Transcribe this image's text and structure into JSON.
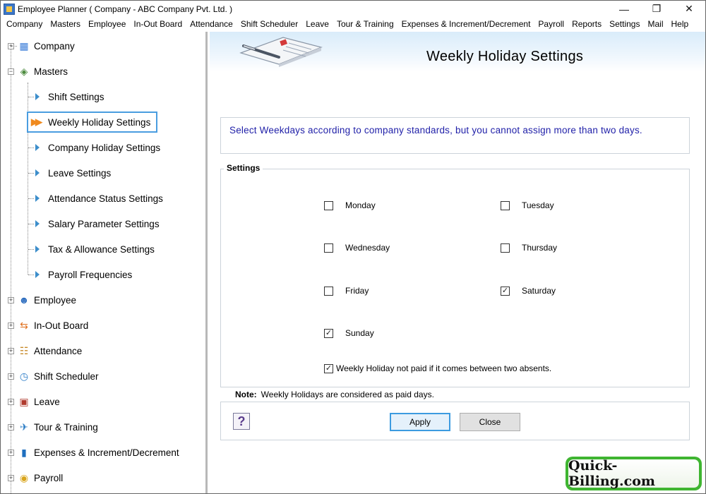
{
  "window": {
    "title": "Employee Planner ( Company - ABC Company Pvt. Ltd. )",
    "controls": [
      "minimize-icon",
      "restore-icon",
      "close-icon"
    ]
  },
  "menu": [
    "Company",
    "Masters",
    "Employee",
    "In-Out Board",
    "Attendance",
    "Shift Scheduler",
    "Leave",
    "Tour & Training",
    "Expenses & Increment/Decrement",
    "Payroll",
    "Reports",
    "Settings",
    "Mail",
    "Help"
  ],
  "tree": {
    "company": "Company",
    "masters": "Masters",
    "masters_children": [
      "Shift Settings",
      "Weekly Holiday Settings",
      "Company Holiday Settings",
      "Leave Settings",
      "Attendance Status Settings",
      "Salary Parameter Settings",
      "Tax & Allowance Settings",
      "Payroll Frequencies"
    ],
    "selected": "Weekly Holiday Settings",
    "others": [
      "Employee",
      "In-Out Board",
      "Attendance",
      "Shift Scheduler",
      "Leave",
      "Tour & Training",
      "Expenses & Increment/Decrement",
      "Payroll"
    ]
  },
  "page": {
    "title": "Weekly Holiday Settings",
    "info": "Select Weekdays according to company standards, but you cannot assign more than two days.",
    "settings_legend": "Settings",
    "days": [
      {
        "label": "Monday",
        "checked": false
      },
      {
        "label": "Tuesday",
        "checked": false
      },
      {
        "label": "Wednesday",
        "checked": false
      },
      {
        "label": "Thursday",
        "checked": false
      },
      {
        "label": "Friday",
        "checked": false
      },
      {
        "label": "Saturday",
        "checked": true
      },
      {
        "label": "Sunday",
        "checked": true
      }
    ],
    "not_paid_option": {
      "label": "Weekly Holiday not paid if it comes between two absents.",
      "checked": true
    },
    "note_label": "Note:",
    "note_text": "Weekly Holidays are considered as paid days.",
    "help_glyph": "?",
    "apply_label": "Apply",
    "close_label": "Close"
  },
  "badge": "Quick-Billing.com",
  "colors": {
    "accent": "#3c9be0",
    "info_text": "#1f1fa8",
    "badge_green": "#3fb531",
    "tree_arrow": "#3d8ecb",
    "selected_arrow": "#f08a1e"
  }
}
